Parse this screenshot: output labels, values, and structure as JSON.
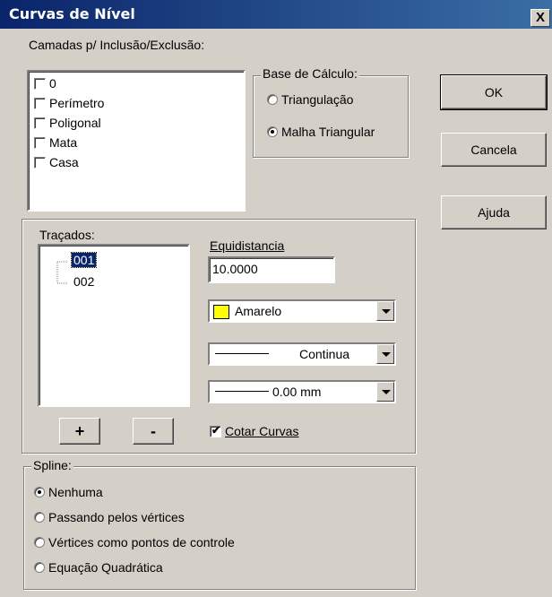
{
  "window": {
    "title": "Curvas de Nível",
    "close_glyph": "X"
  },
  "camadas": {
    "legend": "Camadas p/ Inclusão/Exclusão:",
    "items": [
      "0",
      "Perímetro",
      "Poligonal",
      "Mata",
      "Casa"
    ]
  },
  "base": {
    "legend": "Base de Cálculo:",
    "options": [
      "Triangulação",
      "Malha Triangular"
    ],
    "selected": 1
  },
  "buttons": {
    "ok": "OK",
    "cancel": "Cancela",
    "help": "Ajuda"
  },
  "tracados": {
    "legend": "Traçados:",
    "items": [
      "001",
      "002"
    ],
    "selected": 0,
    "add": "+",
    "remove": "-"
  },
  "equidistancia": {
    "label": "Equidistancia",
    "value": "10.0000"
  },
  "color_combo": {
    "value": "Amarelo",
    "swatch": "#ffff00"
  },
  "line_combo": {
    "value": "Continua"
  },
  "width_combo": {
    "value": "0.00 mm"
  },
  "cotar": {
    "label": "Cotar Curvas",
    "checked": true
  },
  "spline": {
    "legend": "Spline:",
    "options": [
      "Nenhuma",
      "Passando pelos vértices",
      "Vértices como pontos de controle",
      "Equação Quadrática"
    ],
    "selected": 0
  }
}
